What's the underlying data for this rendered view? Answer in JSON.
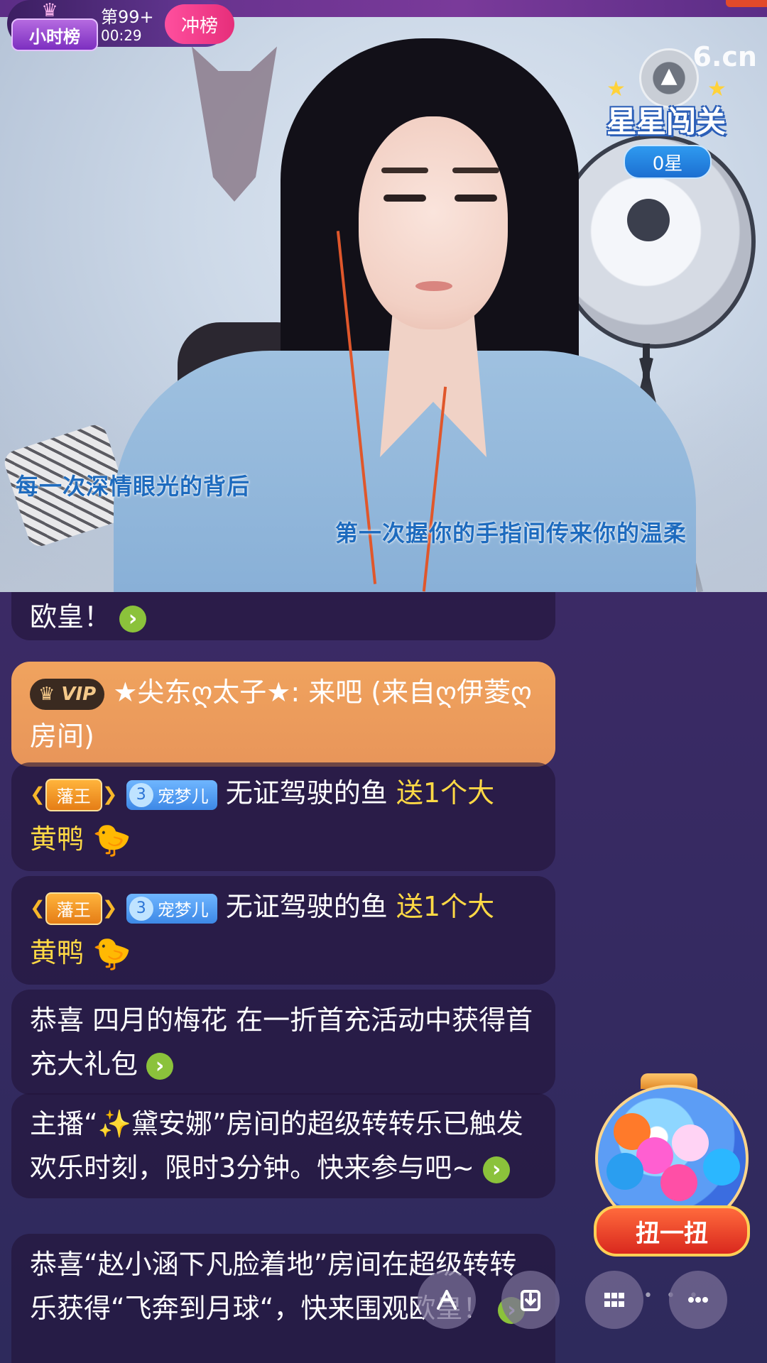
{
  "hour_rank": {
    "logo_label": "小时榜",
    "rank": "第99+",
    "time": "00:29",
    "cta": "冲榜"
  },
  "watermark": "6.cn",
  "star_challenge": {
    "title": "星星闯关",
    "count": "0星"
  },
  "subtitles": {
    "line1": "每一次深情眼光的背后",
    "line2": "第一次握你的手指间传来你的温柔"
  },
  "chat": [
    {
      "type": "partial",
      "text": "欧皇！"
    },
    {
      "type": "vip",
      "badge": "VIP",
      "text": "★尖东ღ太子★: 来吧 (来自ღ伊菱ღ房间)"
    },
    {
      "type": "gift",
      "fan_badge": "藩王",
      "pet_level": "3",
      "pet_badge": "宠梦儿",
      "user": "无证驾驶的鱼",
      "action": "送1个大",
      "gift_tail": "黄鸭"
    },
    {
      "type": "gift",
      "fan_badge": "藩王",
      "pet_level": "3",
      "pet_badge": "宠梦儿",
      "user": "无证驾驶的鱼",
      "action": "送1个大",
      "gift_tail": "黄鸭"
    },
    {
      "type": "notice",
      "text": "恭喜 四月的梅花 在一折首充活动中获得首充大礼包"
    },
    {
      "type": "notice",
      "text": "主播“✨黛安娜”房间的超级转转乐已触发欢乐时刻，限时3分钟。快来参与吧~"
    },
    {
      "type": "notice",
      "text": "恭喜“赵小涵下凡脸着地”房间在超级转转乐获得“飞奔到月球“，快来围观欧皇！"
    }
  ],
  "capsule_machine": {
    "label": "扭一扭"
  },
  "toolbar": {
    "icons": [
      "share-icon",
      "download-icon",
      "grid-icon",
      "more-icon"
    ]
  },
  "colors": {
    "chat_bubble": "#22143899",
    "vip_bubble": "#e8955a",
    "gift_text": "#ffd945",
    "link_arrow": "#8bc23b",
    "hour_rank_cta": "#e62e7a"
  }
}
